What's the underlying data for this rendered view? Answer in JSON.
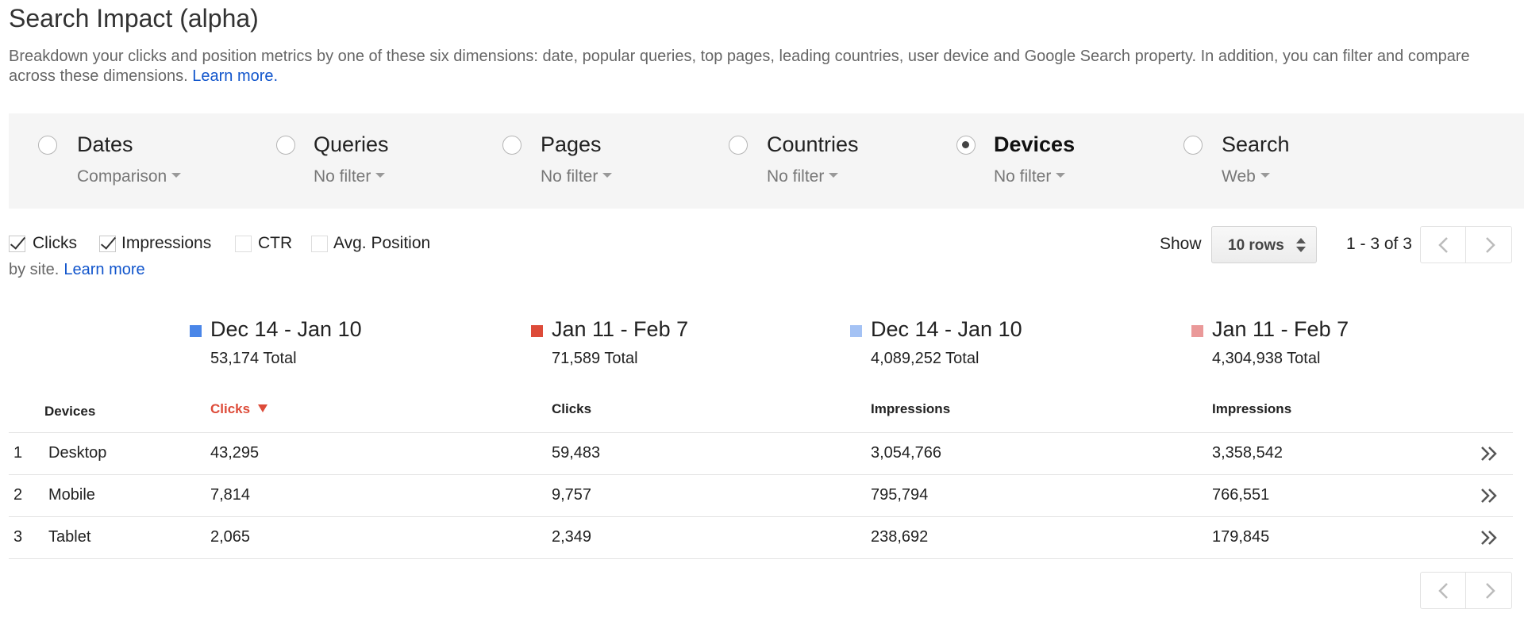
{
  "page": {
    "title": "Search Impact (alpha)",
    "description": "Breakdown your clicks and position metrics by one of these six dimensions: date, popular queries, top pages, leading countries, user device and Google Search property. In addition, you can filter and compare across these dimensions.",
    "learn_more": "Learn more."
  },
  "dimensions": [
    {
      "name": "Dates",
      "filter": "Comparison",
      "selected": false
    },
    {
      "name": "Queries",
      "filter": "No filter",
      "selected": false
    },
    {
      "name": "Pages",
      "filter": "No filter",
      "selected": false
    },
    {
      "name": "Countries",
      "filter": "No filter",
      "selected": false
    },
    {
      "name": "Devices",
      "filter": "No filter",
      "selected": true
    },
    {
      "name": "Search",
      "filter": "Web",
      "selected": false
    }
  ],
  "metrics": [
    {
      "label": "Clicks",
      "checked": true
    },
    {
      "label": "Impressions",
      "checked": true
    },
    {
      "label": "CTR",
      "checked": false
    },
    {
      "label": "Avg. Position",
      "checked": false
    }
  ],
  "bysite": {
    "text": "by site.",
    "link": "Learn more"
  },
  "pagination": {
    "show_label": "Show",
    "rows_value": "10 rows",
    "range": "1 - 3 of 3"
  },
  "series": [
    {
      "range": "Dec 14 - Jan 10",
      "total": "53,174 Total",
      "color": "#4a86e8"
    },
    {
      "range": "Jan 11 - Feb 7",
      "total": "71,589 Total",
      "color": "#dd4b39"
    },
    {
      "range": "Dec 14 - Jan 10",
      "total": "4,089,252 Total",
      "color": "#a4c2f4"
    },
    {
      "range": "Jan 11 - Feb 7",
      "total": "4,304,938 Total",
      "color": "#ea9999"
    }
  ],
  "table": {
    "headers": [
      "Devices",
      "Clicks",
      "Clicks",
      "Impressions",
      "Impressions"
    ],
    "rows": [
      {
        "index": "1",
        "device": "Desktop",
        "values": [
          "43,295",
          "59,483",
          "3,054,766",
          "3,358,542"
        ]
      },
      {
        "index": "2",
        "device": "Mobile",
        "values": [
          "7,814",
          "9,757",
          "795,794",
          "766,551"
        ]
      },
      {
        "index": "3",
        "device": "Tablet",
        "values": [
          "2,065",
          "2,349",
          "238,692",
          "179,845"
        ]
      }
    ]
  }
}
